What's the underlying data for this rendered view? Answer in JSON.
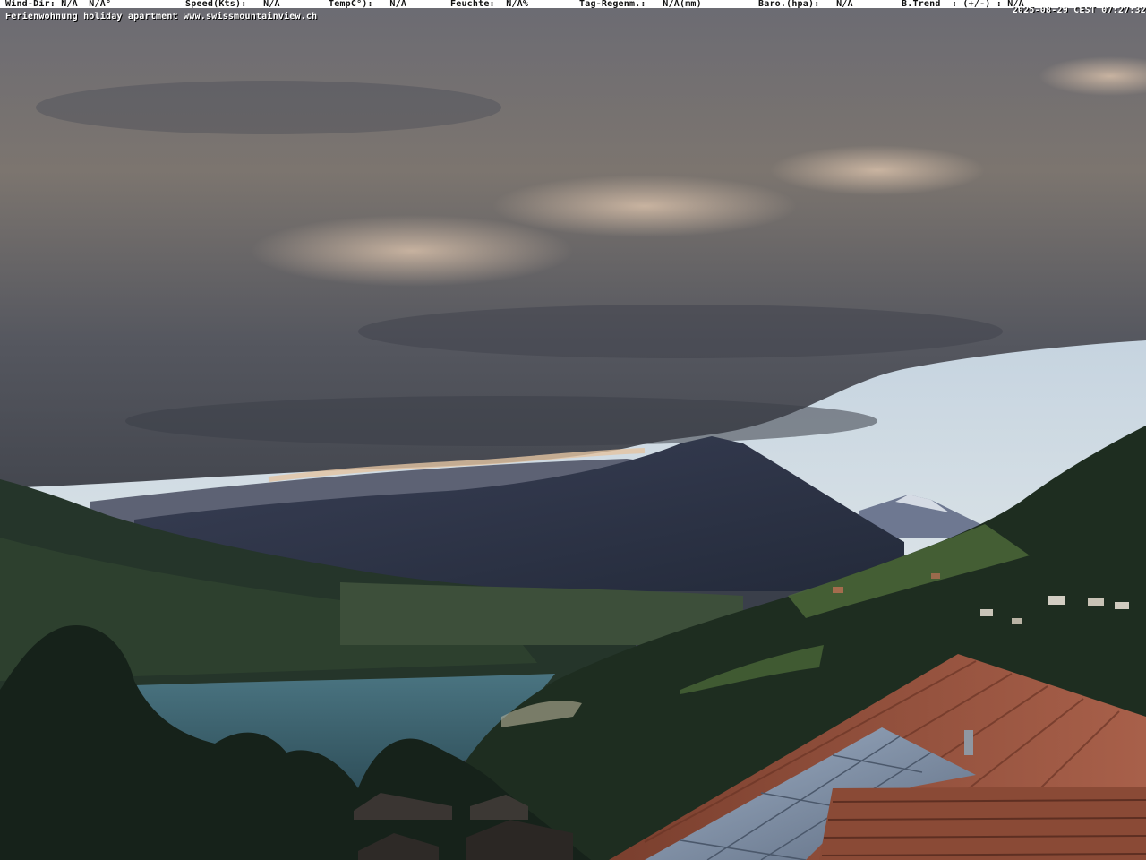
{
  "overlay": {
    "wind_dir": "Wind-Dir: N/A  N/A°",
    "speed": "Speed(Kts):   N/A",
    "temp": "TempC°):   N/A",
    "feuchte": "Feuchte:  N/A%",
    "tag_regen": "Tag-Regenm.:   N/A(mm)",
    "baro": "Baro.(hpa):   N/A",
    "btrend": "B.Trend  : (+/-) : N/A",
    "timestamp": "2025-08-29 CEST 07:27:32",
    "caption": "Ferienwohnung holiday apartment www.swissmountainview.ch"
  },
  "colors": {
    "sky_blue": "#b9cde0",
    "cloud_dark": "#5a5c66",
    "cloud_lit": "#b8a69a",
    "mountain": "#2c3448",
    "lake": "#3e6370",
    "forest": "#1c2a1f",
    "roof_tile": "#a0553c",
    "solar_panel": "#8a9ab0"
  }
}
